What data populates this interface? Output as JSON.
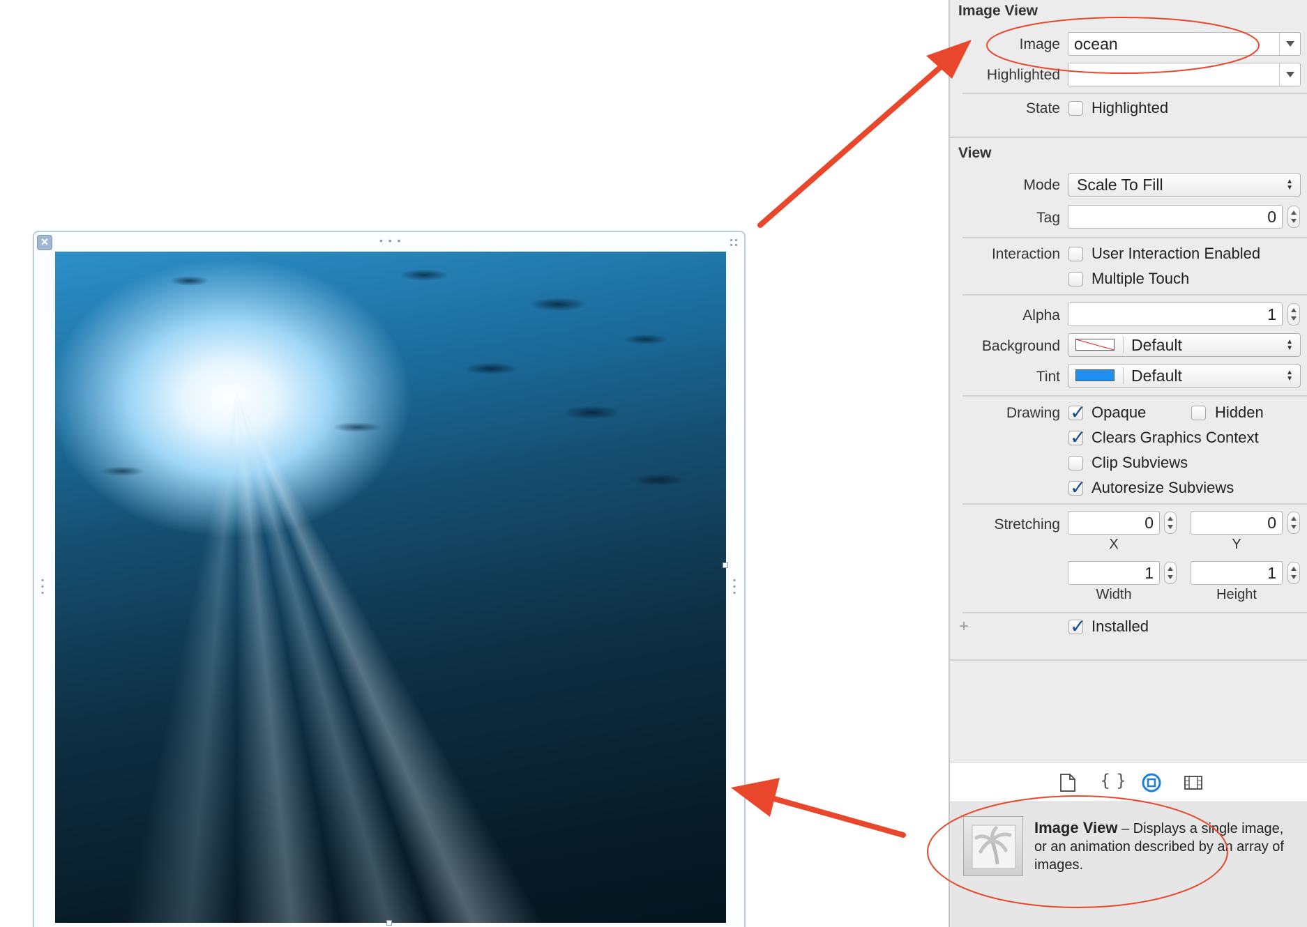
{
  "inspector": {
    "image_view_section": {
      "title": "Image View",
      "image_label": "Image",
      "image_value": "ocean",
      "highlighted_label": "Highlighted",
      "highlighted_value": "",
      "state_label": "State",
      "state_checkbox_label": "Highlighted",
      "state_checked": false
    },
    "view_section": {
      "title": "View",
      "mode_label": "Mode",
      "mode_value": "Scale To Fill",
      "tag_label": "Tag",
      "tag_value": "0",
      "interaction_label": "Interaction",
      "user_interaction_label": "User Interaction Enabled",
      "user_interaction_checked": false,
      "multiple_touch_label": "Multiple Touch",
      "multiple_touch_checked": false,
      "alpha_label": "Alpha",
      "alpha_value": "1",
      "background_label": "Background",
      "background_value": "Default",
      "tint_label": "Tint",
      "tint_value": "Default",
      "tint_color": "#1e8ff0",
      "drawing_label": "Drawing",
      "opaque_label": "Opaque",
      "opaque_checked": true,
      "hidden_label": "Hidden",
      "hidden_checked": false,
      "clears_label": "Clears Graphics Context",
      "clears_checked": true,
      "clip_label": "Clip Subviews",
      "clip_checked": false,
      "autoresize_label": "Autoresize Subviews",
      "autoresize_checked": true,
      "stretching_label": "Stretching",
      "stretch_x": "0",
      "stretch_y": "0",
      "stretch_width": "1",
      "stretch_height": "1",
      "x_label": "X",
      "y_label": "Y",
      "width_label": "Width",
      "height_label": "Height",
      "installed_label": "Installed",
      "installed_checked": true,
      "add_symbol": "+"
    },
    "library_tabs": [
      "file-icon",
      "braces-icon",
      "object-icon",
      "media-icon"
    ],
    "library_item": {
      "name": "Image View",
      "description": " – Displays a single image, or an animation described by an array of images."
    }
  },
  "canvas": {
    "image_name": "ocean"
  },
  "colors": {
    "annotation_red": "#e8472b",
    "selected_tab_blue": "#1a7fe0"
  }
}
